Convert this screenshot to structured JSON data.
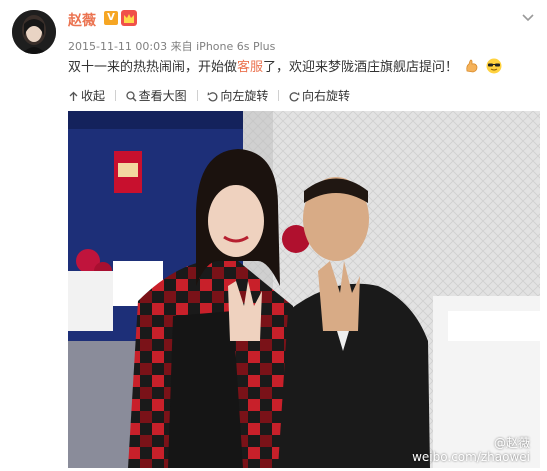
{
  "post": {
    "author": "赵薇",
    "verified_badge": "V",
    "timestamp": "2015-11-11 00:03",
    "source_prefix": "来自",
    "source": "iPhone 6s Plus",
    "text_before": "双十一来的热热闹闹，开始做",
    "text_highlight": "客服",
    "text_after": "了，欢迎来梦陇酒庄旗舰店提问！",
    "emojis": [
      "muscle-emoji",
      "sunglasses-emoji"
    ]
  },
  "toolbar": {
    "collapse_label": "收起",
    "view_large_label": "查看大图",
    "rotate_left_label": "向左旋转",
    "rotate_right_label": "向右旋转"
  },
  "photo": {
    "watermark_handle": "@赵薇",
    "watermark_url": "weibo.com/zhaowei"
  },
  "colors": {
    "author": "#eb7350",
    "highlight": "#eb7350",
    "meta": "#808080",
    "text": "#333333"
  }
}
